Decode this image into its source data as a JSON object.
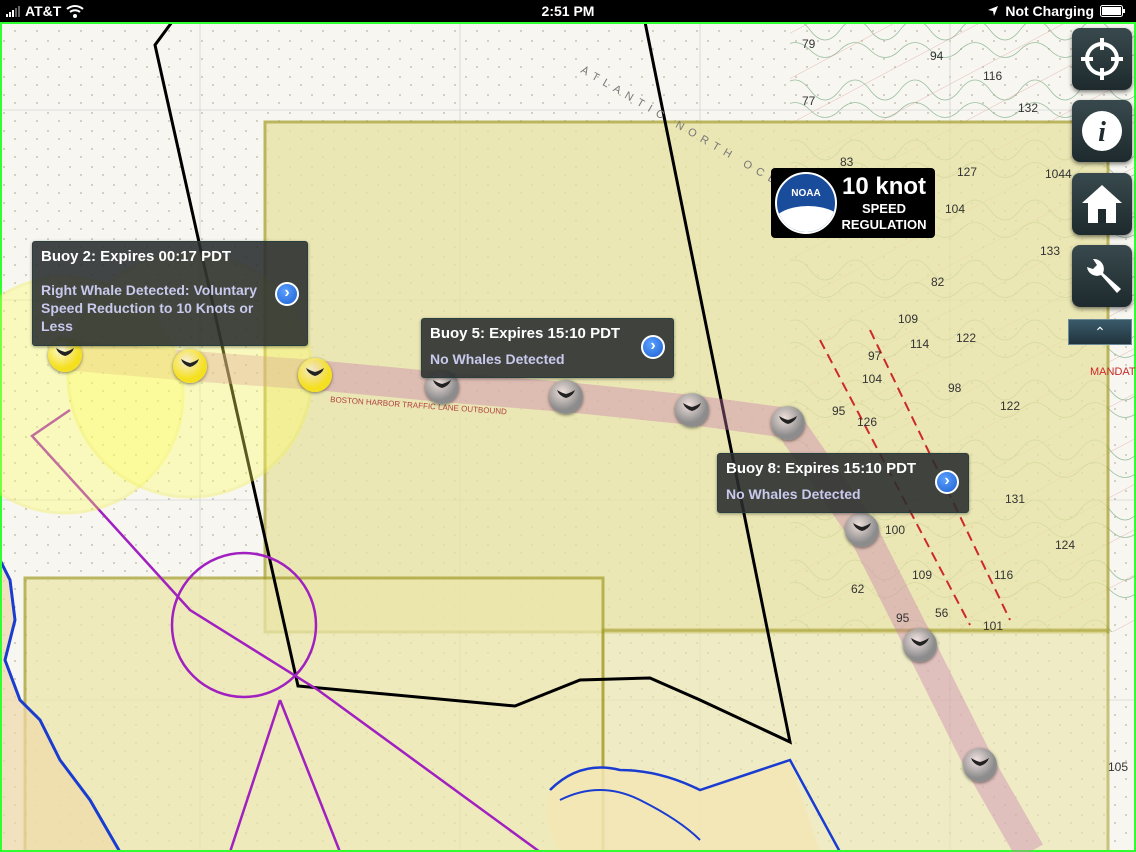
{
  "status_bar": {
    "carrier": "AT&T",
    "time": "2:51 PM",
    "charging": "Not Charging"
  },
  "callouts": [
    {
      "title": "Buoy 2: Expires 00:17 PDT",
      "status": "Right Whale Detected: Voluntary Speed Reduction to 10 Knots or Less"
    },
    {
      "title": "Buoy 5: Expires 15:10 PDT",
      "status": "No Whales Detected"
    },
    {
      "title": "Buoy 8: Expires 15:10 PDT",
      "status": "No Whales Detected"
    }
  ],
  "badge": {
    "logo_text": "NOAA",
    "speed": "10 knot",
    "line1": "SPEED",
    "line2": "REGULATION"
  },
  "chart_labels": {
    "depths": [
      "79",
      "94",
      "116",
      "132",
      "77",
      "83",
      "127",
      "1044",
      "104",
      "133",
      "82",
      "109",
      "114",
      "122",
      "97",
      "104",
      "98",
      "126",
      "122",
      "95",
      "100",
      "131",
      "109",
      "116",
      "124",
      "62",
      "95",
      "56",
      "101",
      "105"
    ],
    "ocean": "ATLANTIC NORTH OCEAN",
    "lane": "BOSTON HARBOR TRAFFIC LANE OUTBOUND",
    "mandatory": "MANDATORY"
  },
  "buoys": {
    "whale_color": "#f5e020",
    "clear_color": "#8c8c8c"
  }
}
